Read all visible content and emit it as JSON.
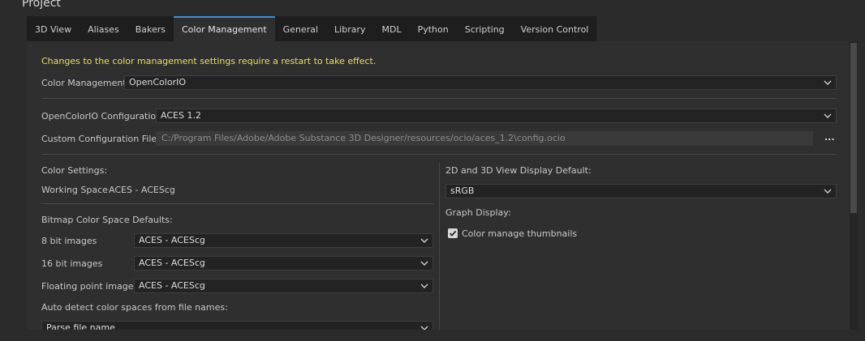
{
  "window": {
    "title": "Project"
  },
  "tabs": [
    {
      "label": "3D View"
    },
    {
      "label": "Aliases"
    },
    {
      "label": "Bakers"
    },
    {
      "label": "Color Management",
      "active": true
    },
    {
      "label": "General"
    },
    {
      "label": "Library"
    },
    {
      "label": "MDL"
    },
    {
      "label": "Python"
    },
    {
      "label": "Scripting"
    },
    {
      "label": "Version Control"
    }
  ],
  "notice": "Changes to the color management settings require a restart to take effect.",
  "color_management": {
    "label": "Color Management",
    "value": "OpenColorIO"
  },
  "ocio_config": {
    "label": "OpenColorIO Configuration",
    "value": "ACES 1.2"
  },
  "custom_config": {
    "label": "Custom Configuration File",
    "path": "C:/Program Files/Adobe/Adobe Substance 3D Designer/resources/ocio/aces_1.2\\config.ocio",
    "browse_label": "..."
  },
  "color_settings": {
    "heading": "Color Settings:",
    "working_space_label": "Working Space",
    "working_space_value": "ACES - ACEScg"
  },
  "bitmap_defaults": {
    "heading": "Bitmap Color Space Defaults:",
    "rows": [
      {
        "label": "8 bit images",
        "value": "ACES - ACEScg"
      },
      {
        "label": "16 bit images",
        "value": "ACES - ACEScg"
      },
      {
        "label": "Floating point images",
        "value": "ACES - ACEScg"
      }
    ]
  },
  "auto_detect": {
    "label": "Auto detect color spaces from file names:",
    "value": "Parse file name"
  },
  "view_display": {
    "heading": "2D and 3D View Display Default:",
    "value": "sRGB"
  },
  "graph_display": {
    "heading": "Graph Display:",
    "checkbox_label": "Color manage thumbnails",
    "checked": true
  },
  "colors": {
    "accent": "#3d8ee0",
    "warning": "#e8e05a",
    "background": "#2b2b2b"
  }
}
